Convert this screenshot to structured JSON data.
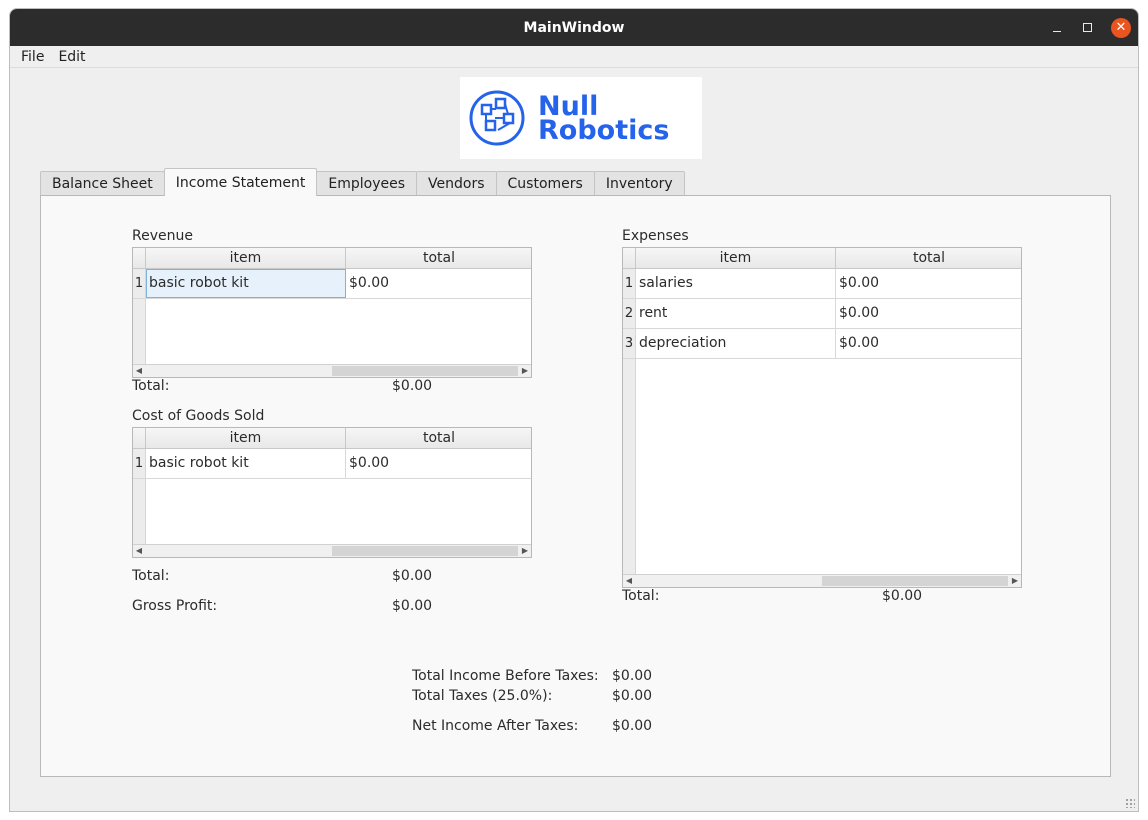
{
  "window": {
    "title": "MainWindow"
  },
  "menu": {
    "items": [
      "File",
      "Edit"
    ]
  },
  "logo": {
    "line1": "Null",
    "line2": "Robotics",
    "color": "#2563eb"
  },
  "tabs": [
    "Balance Sheet",
    "Income Statement",
    "Employees",
    "Vendors",
    "Customers",
    "Inventory"
  ],
  "active_tab": "Income Statement",
  "revenue": {
    "label": "Revenue",
    "columns": [
      "item",
      "total"
    ],
    "rows": [
      {
        "num": "1",
        "item": "basic robot kit",
        "total": "$0.00"
      }
    ],
    "total_label": "Total:",
    "total_value": "$0.00"
  },
  "cogs": {
    "label": "Cost of Goods Sold",
    "columns": [
      "item",
      "total"
    ],
    "rows": [
      {
        "num": "1",
        "item": "basic robot kit",
        "total": "$0.00"
      }
    ],
    "total_label": "Total:",
    "total_value": "$0.00"
  },
  "gross_profit": {
    "label": "Gross Profit:",
    "value": "$0.00"
  },
  "expenses": {
    "label": "Expenses",
    "columns": [
      "item",
      "total"
    ],
    "rows": [
      {
        "num": "1",
        "item": "salaries",
        "total": "$0.00"
      },
      {
        "num": "2",
        "item": "rent",
        "total": "$0.00"
      },
      {
        "num": "3",
        "item": "depreciation",
        "total": "$0.00"
      }
    ],
    "total_label": "Total:",
    "total_value": "$0.00"
  },
  "summary": {
    "income_before_taxes_label": "Total Income Before Taxes:",
    "income_before_taxes_value": "$0.00",
    "taxes_label": "Total Taxes (25.0%):",
    "taxes_value": "$0.00",
    "net_income_label": "Net Income After Taxes:",
    "net_income_value": "$0.00"
  }
}
